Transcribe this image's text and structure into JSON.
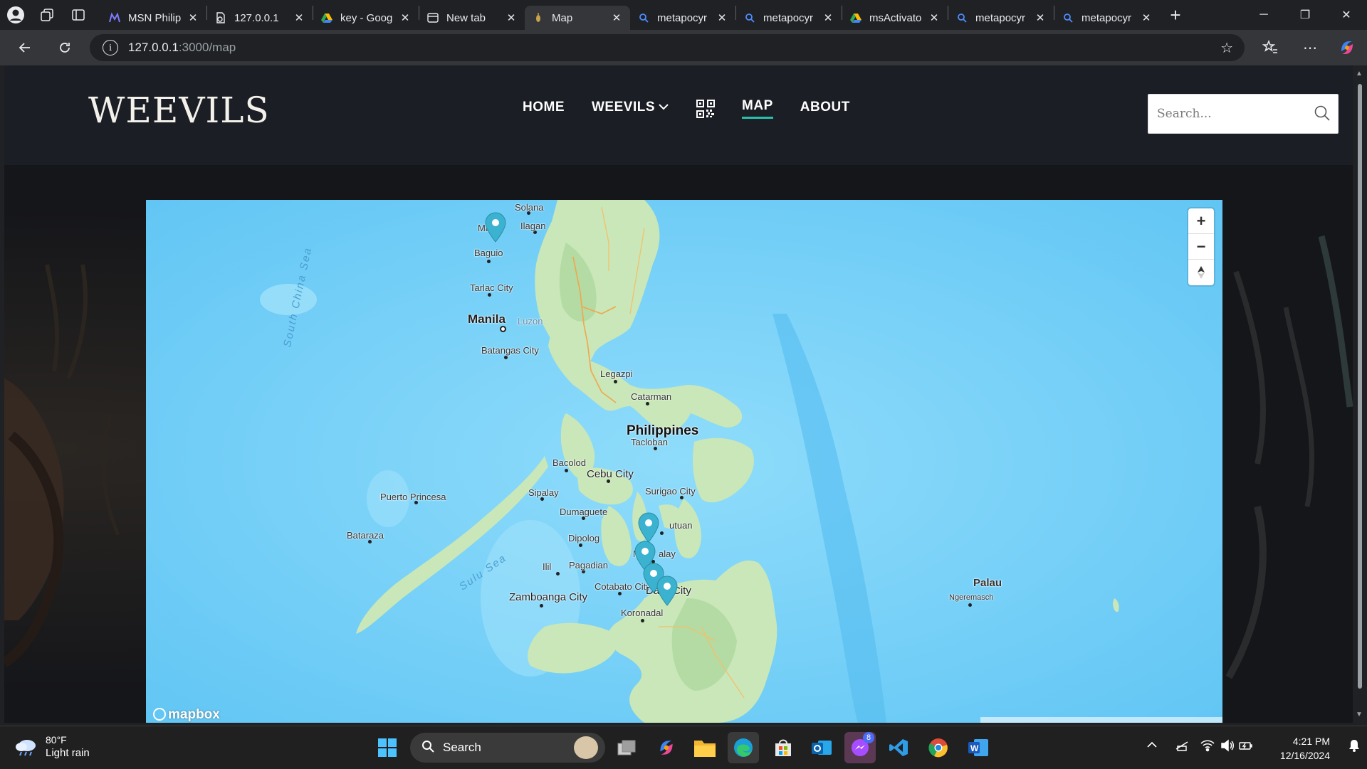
{
  "browser": {
    "tabs": [
      {
        "title": "MSN Philip",
        "favicon": "msn-icon",
        "active": false
      },
      {
        "title": "127.0.0.1",
        "favicon": "page-icon",
        "active": false
      },
      {
        "title": "key - Goog",
        "favicon": "drive-icon",
        "active": false
      },
      {
        "title": "New tab",
        "favicon": "newtab-icon",
        "active": false
      },
      {
        "title": "Map",
        "favicon": "weevil-icon",
        "active": true
      },
      {
        "title": "metapocyr",
        "favicon": "search-icon",
        "active": false
      },
      {
        "title": "metapocyr",
        "favicon": "search-icon",
        "active": false
      },
      {
        "title": "msActivato",
        "favicon": "drive-icon",
        "active": false
      },
      {
        "title": "metapocyr",
        "favicon": "search-icon",
        "active": false
      },
      {
        "title": "metapocyr",
        "favicon": "search-icon",
        "active": false
      }
    ],
    "close_glyph": "✕",
    "new_tab_glyph": "+",
    "address": {
      "host": "127.0.0.1",
      "path": ":3000/map"
    }
  },
  "site": {
    "logo": "WEEVILS",
    "nav": {
      "home": "HOME",
      "weevils": "WEEVILS",
      "map": "MAP",
      "about": "ABOUT"
    },
    "search_placeholder": "Search..."
  },
  "map": {
    "labels": {
      "solana": "Solana",
      "mabini": "Mabi",
      "ilagan": "Ilagan",
      "baguio": "Baguio",
      "tarlac": "Tarlac City",
      "manila": "Manila",
      "luzon": "Luzon",
      "batangas": "Batangas City",
      "legazpi": "Legazpi",
      "catarman": "Catarman",
      "philippines": "Philippines",
      "tacloban": "Tacloban",
      "bacolod": "Bacolod",
      "cebu": "Cebu City",
      "sipalay": "Sipalay",
      "dumaguete": "Dumaguete",
      "surigao": "Surigao City",
      "butuan": "utuan",
      "puerto": "Puerto Princesa",
      "bataraza": "Bataraza",
      "dipolog": "Dipolog",
      "malaybalay": "M",
      "malaybalay2": "alay",
      "iligan": "Ilil",
      "pagadian": "Pagadian",
      "cotabato": "Cotabato City",
      "davao1": "Dav",
      "davao2": "City",
      "zamboanga": "Zamboanga City",
      "koronadal": "Koronadal",
      "palau": "Palau",
      "ngeremasch": "Ngeremasch",
      "south_china_sea": "South China Sea",
      "sulu_sea": "Sulu Sea"
    },
    "zoom_in": "+",
    "zoom_out": "−",
    "compass": "▲",
    "provider_logo": "mapbox",
    "marker_color": "#3bb2d0"
  },
  "taskbar": {
    "weather_temp": "80°F",
    "weather_cond": "Light rain",
    "search_label": "Search",
    "messenger_badge": "8",
    "time": "4:21 PM",
    "date": "12/16/2024"
  }
}
